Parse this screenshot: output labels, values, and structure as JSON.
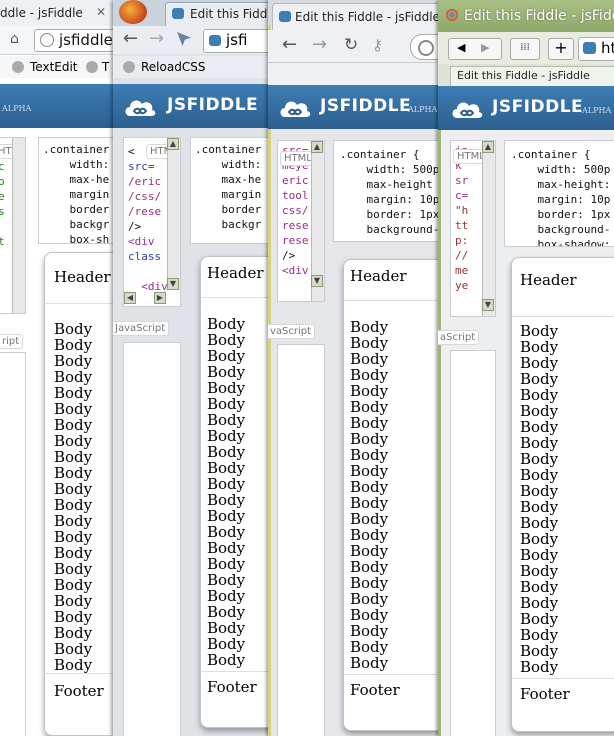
{
  "windows": [
    {
      "tab_title": "ddle - jsFiddle",
      "address": "jsfiddle.",
      "bookmarks": [
        "TextEdit",
        "T"
      ],
      "logo": "",
      "css_lines": [
        ".container",
        "    width:",
        "    max-he",
        "    margin",
        "    border",
        "    backgr",
        "    box-sh"
      ],
      "html_lines": [
        "",
        "c",
        "o",
        "e",
        "s",
        "",
        "t",
        "",
        ""
      ],
      "html_label": "HTML",
      "js_label": "ript",
      "header": "Header",
      "footer": "Footer"
    },
    {
      "tab_title": "Edit this Fiddle",
      "bookmarks": [
        "ReloadCSS"
      ],
      "logo": "JSFIDDLE",
      "alpha": "ALPHA",
      "css_lines": [
        ".container",
        "    width:",
        "    max-he",
        "    margin",
        "    border",
        "    backgr"
      ],
      "html_lines": [
        "<",
        "src=",
        "/eric",
        "/css/",
        "/rese",
        "/>",
        "<div",
        "class",
        "",
        "  <div"
      ],
      "html_label": "HTML",
      "js_label": "JavaScript",
      "header": "Header",
      "footer": "Footer"
    },
    {
      "tab_title": "Edit this Fiddle - jsFiddle",
      "logo": "JSFIDDLE",
      "alpha": "ALPHA",
      "css_lines": [
        ".container {",
        "    width: 500p",
        "    max-height",
        "    margin: 10p",
        "    border: 1px",
        "    background-"
      ],
      "html_lines": [
        "src=",
        "meye",
        "eric",
        "tool",
        "css/",
        "rese",
        "rese",
        "/>",
        "<div"
      ],
      "html_label": "HTML",
      "js_label": "vaScript",
      "header": "Header",
      "footer": "Footer"
    },
    {
      "tab_title": "Edit this Fiddle - jsFiddle",
      "tab_strip_title": "Edit this Fiddle - jsFiddle",
      "address": "htt",
      "logo": "JSFIDDLE",
      "alpha": "ALPHA",
      "css_lines": [
        ".container {",
        "    width: 500p",
        "    max-height:",
        "    margin: 10p",
        "    border: 1px",
        "    background-",
        "    box-shadow:"
      ],
      "html_lines": [
        "in",
        "k",
        "sr",
        "c=",
        "\"h",
        "tt",
        "p:",
        "//",
        "me",
        "ye"
      ],
      "html_label": "HTML",
      "js_label": "aScript",
      "header": "Header",
      "footer": "Footer"
    }
  ],
  "body_word": "Body",
  "body_count": 22
}
